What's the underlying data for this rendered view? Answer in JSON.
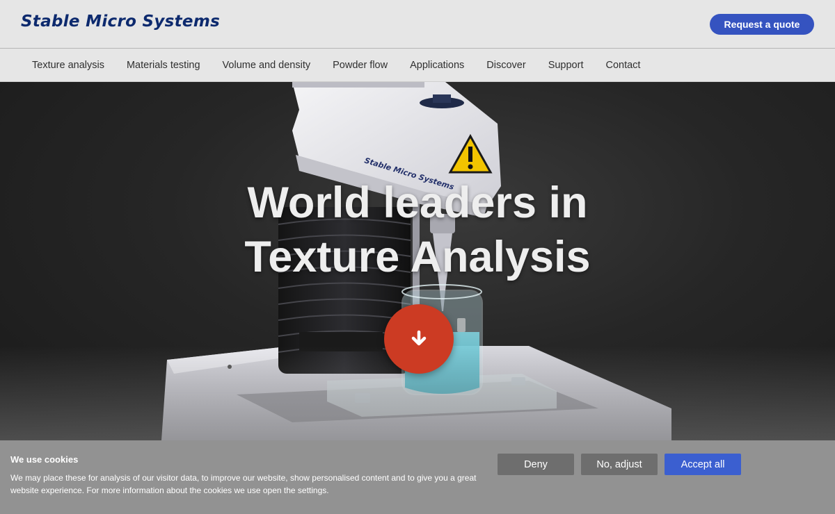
{
  "header": {
    "logo_text": "Stable Micro Systems",
    "quote_button": "Request a quote"
  },
  "nav": {
    "items": [
      {
        "label": "Texture analysis"
      },
      {
        "label": "Materials testing"
      },
      {
        "label": "Volume and density"
      },
      {
        "label": "Powder flow"
      },
      {
        "label": "Applications"
      },
      {
        "label": "Discover"
      },
      {
        "label": "Support"
      },
      {
        "label": "Contact"
      }
    ]
  },
  "hero": {
    "title_line1": "World leaders in",
    "title_line2": "Texture Analysis",
    "machine_label": "Stable Micro Systems",
    "scroll_icon": "arrow-down-icon"
  },
  "cookie_banner": {
    "title": "We use cookies",
    "text": "We may place these for analysis of our visitor data, to improve our website, show personalised content and to give you a great website experience. For more information about the cookies we use open the settings.",
    "deny": "Deny",
    "adjust": "No, adjust",
    "accept": "Accept all"
  },
  "colors": {
    "brand": "#0d2a6e",
    "primary_button": "#3553c0",
    "scroll_button": "#cc3b23",
    "accept_button": "#3b5fd0"
  }
}
